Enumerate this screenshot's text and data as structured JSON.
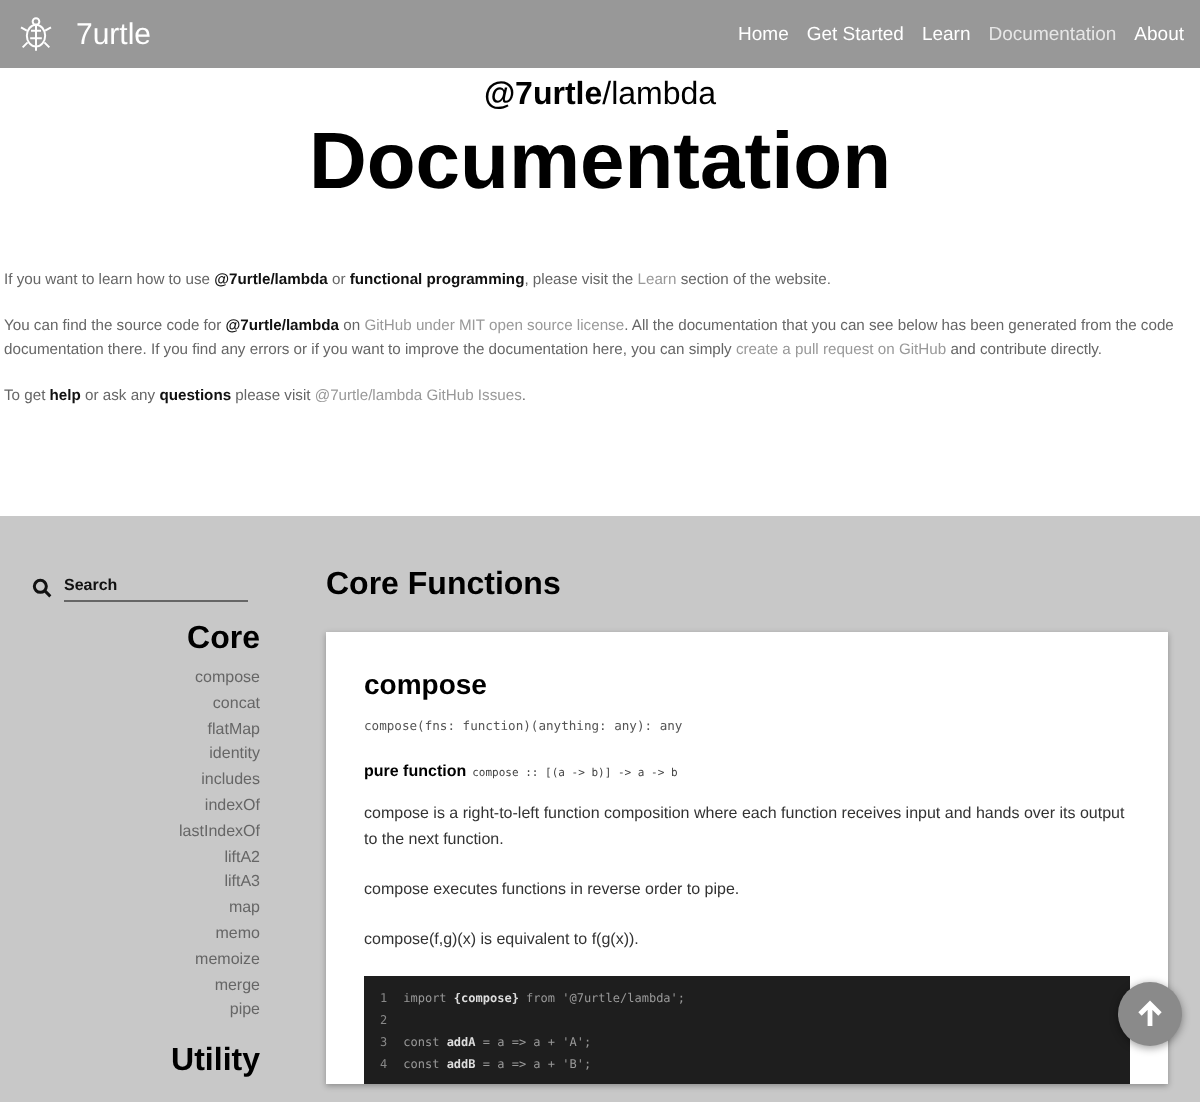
{
  "navbar": {
    "brand": "7urtle",
    "links": [
      {
        "label": "Home",
        "selected": false
      },
      {
        "label": "Get Started",
        "selected": false
      },
      {
        "label": "Learn",
        "selected": false
      },
      {
        "label": "Documentation",
        "selected": true
      },
      {
        "label": "About",
        "selected": false
      }
    ]
  },
  "header": {
    "subtitle": "**@7urtle**/lambda",
    "title": "Documentation"
  },
  "intro": [
    {
      "parts": [
        {
          "kind": "text",
          "text": "If you want to learn how to use **@7urtle/lambda** or **functional programming**, please visit the "
        },
        {
          "kind": "link",
          "text": "Learn"
        },
        {
          "kind": "text",
          "text": " section of the website."
        }
      ]
    },
    {
      "parts": [
        {
          "kind": "text",
          "text": "You can find the source code for **@7urtle/lambda** on "
        },
        {
          "kind": "link",
          "text": "GitHub under MIT open source license"
        },
        {
          "kind": "text",
          "text": ". All the documentation that you can see below has been generated from the code documentation there. If you find any errors or if you want to improve the documentation here, you can simply "
        },
        {
          "kind": "link",
          "text": "create a pull request on GitHub"
        },
        {
          "kind": "text",
          "text": " and contribute directly."
        }
      ]
    },
    {
      "parts": [
        {
          "kind": "text",
          "text": "To get **help** or ask any **questions** please visit "
        },
        {
          "kind": "link",
          "text": "@7urtle/lambda GitHub Issues"
        },
        {
          "kind": "text",
          "text": "."
        }
      ]
    }
  ],
  "sidebar": {
    "search": {
      "placeholder": "Search"
    },
    "groups": [
      {
        "title": "Core",
        "items": [
          "compose",
          "concat",
          "flatMap",
          "identity",
          "includes",
          "indexOf",
          "lastIndexOf",
          "liftA2",
          "liftA3",
          "map",
          "memo",
          "memoize",
          "merge",
          "pipe"
        ]
      },
      {
        "title": "Utility"
      }
    ]
  },
  "section": {
    "title": "Core Functions",
    "card": {
      "name": "compose",
      "signature": "compose(fns: function)(anything: any): any",
      "pure_label": "pure function",
      "pure_signature": "compose :: [(a -> b)] -> a -> b",
      "paragraphs": [
        "compose is a right-to-left function composition where each function receives input and hands over its output to the next function.",
        "compose executes functions in reverse order to pipe.",
        "compose(f,g)(x) is equivalent to f(g(x))."
      ],
      "code": [
        {
          "number": "1",
          "text": "import **{compose}** from '@7urtle/lambda';"
        },
        {
          "number": "2"
        },
        {
          "number": "3",
          "text": "const **addA** = a => a + 'A';"
        },
        {
          "number": "4",
          "text": "const **addB** = a => a + 'B';"
        }
      ]
    }
  },
  "scroll_top_button": {
    "shown": true
  }
}
